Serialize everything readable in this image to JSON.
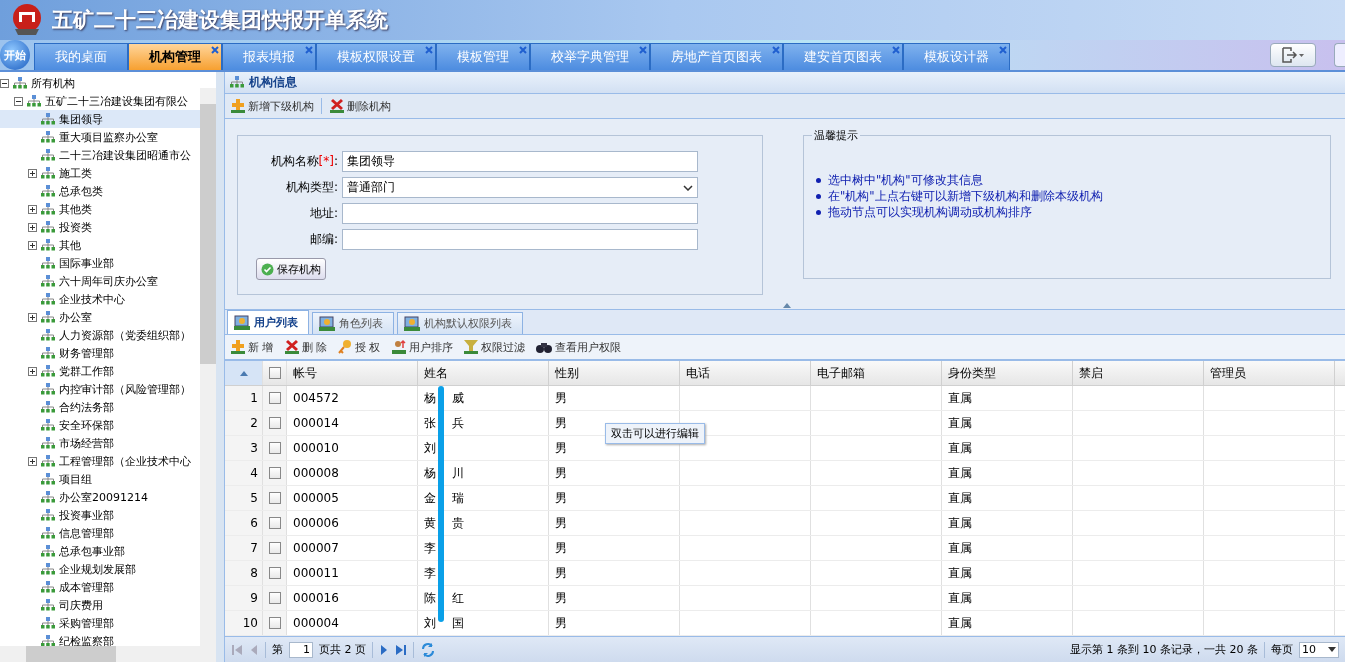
{
  "header": {
    "title": "五矿二十三冶建设集团快报开单系统"
  },
  "start_button": "开始",
  "tabs": [
    {
      "label": "我的桌面",
      "selected": false,
      "closable": false
    },
    {
      "label": "机构管理",
      "selected": true,
      "closable": true
    },
    {
      "label": "报表填报",
      "selected": false,
      "closable": true
    },
    {
      "label": "模板权限设置",
      "selected": false,
      "closable": true
    },
    {
      "label": "模板管理",
      "selected": false,
      "closable": true
    },
    {
      "label": "校举字典管理",
      "selected": false,
      "closable": true
    },
    {
      "label": "房地产首页图表",
      "selected": false,
      "closable": true
    },
    {
      "label": "建安首页图表",
      "selected": false,
      "closable": true
    },
    {
      "label": "模板设计器",
      "selected": false,
      "closable": true
    }
  ],
  "tree": [
    {
      "label": "所有机构",
      "expanded": true,
      "selected": false,
      "children": [
        {
          "label": "五矿二十三冶建设集团有限公",
          "expanded": true,
          "selected": false,
          "children": [
            {
              "label": "集团领导",
              "selected": true
            },
            {
              "label": "重大项目监察办公室",
              "selected": false
            },
            {
              "label": "二十三冶建设集团昭通市公",
              "selected": false
            },
            {
              "label": "施工类",
              "expanded": false,
              "selected": false
            },
            {
              "label": "总承包类",
              "selected": false
            },
            {
              "label": "其他类",
              "expanded": false,
              "selected": false
            },
            {
              "label": "投资类",
              "expanded": false,
              "selected": false
            },
            {
              "label": "其他",
              "expanded": false,
              "selected": false
            },
            {
              "label": "国际事业部",
              "selected": false
            },
            {
              "label": "六十周年司庆办公室",
              "selected": false
            },
            {
              "label": "企业技术中心",
              "selected": false
            },
            {
              "label": "办公室",
              "expanded": false,
              "selected": false
            },
            {
              "label": "人力资源部（党委组织部）",
              "selected": false
            },
            {
              "label": "财务管理部",
              "selected": false
            },
            {
              "label": "党群工作部",
              "expanded": false,
              "selected": false
            },
            {
              "label": "内控审计部（风险管理部）",
              "selected": false
            },
            {
              "label": "合约法务部",
              "selected": false
            },
            {
              "label": "安全环保部",
              "selected": false
            },
            {
              "label": "市场经营部",
              "selected": false
            },
            {
              "label": "工程管理部（企业技术中心",
              "expanded": false,
              "selected": false
            },
            {
              "label": "项目组",
              "selected": false
            },
            {
              "label": "办公室20091214",
              "selected": false
            },
            {
              "label": "投资事业部",
              "selected": false
            },
            {
              "label": "信息管理部",
              "selected": false
            },
            {
              "label": "总承包事业部",
              "selected": false
            },
            {
              "label": "企业规划发展部",
              "selected": false
            },
            {
              "label": "成本管理部",
              "selected": false
            },
            {
              "label": "司庆费用",
              "selected": false
            },
            {
              "label": "采购管理部",
              "selected": false
            },
            {
              "label": "纪检监察部",
              "selected": false
            }
          ]
        }
      ]
    }
  ],
  "panel": {
    "title": "机构信息",
    "toolbar": [
      {
        "label": "新增下级机构",
        "kind": "add"
      },
      {
        "label": "删除机构",
        "kind": "delete"
      }
    ]
  },
  "form": {
    "fields": [
      {
        "label": "机构名称",
        "required": "[*]",
        "label_end": ":",
        "kind": "text",
        "value": "集团领导"
      },
      {
        "label": "机构类型:",
        "kind": "select",
        "value": "普通部门"
      },
      {
        "label": "地址:",
        "kind": "text"
      },
      {
        "label": "邮编:",
        "kind": "text"
      }
    ],
    "save_button": "保存机构"
  },
  "tips": {
    "title": "温馨提示",
    "items": [
      "选中树中\"机构\"可修改其信息",
      "在\"机构\"上点右键可以新增下级机构和删除本级机构",
      "拖动节点可以实现机构调动或机构排序"
    ]
  },
  "subtabs": [
    {
      "label": "用户列表",
      "selected": true
    },
    {
      "label": "角色列表",
      "selected": false
    },
    {
      "label": "机构默认权限列表",
      "selected": false
    }
  ],
  "grid_toolbar": [
    {
      "label": "新 增",
      "kind": "add"
    },
    {
      "label": "删 除",
      "kind": "delete"
    },
    {
      "label": "授 权",
      "kind": "key"
    },
    {
      "label": "用户排序",
      "kind": "sort"
    },
    {
      "label": "权限过滤",
      "kind": "filter"
    },
    {
      "label": "查看用户权限",
      "kind": "binoculars"
    }
  ],
  "grid": {
    "select_all_checked": false,
    "columns": [
      "帐号",
      "姓名",
      "性别",
      "电话",
      "电子邮箱",
      "身份类型",
      "禁启",
      "管理员"
    ],
    "rows": [
      {
        "num": "1",
        "checked": false,
        "account": "004572",
        "name": "杨 威",
        "gender": "男",
        "identity": "直属"
      },
      {
        "num": "2",
        "checked": false,
        "account": "000014",
        "name": "张 兵",
        "gender": "男",
        "identity": "直属"
      },
      {
        "num": "3",
        "checked": false,
        "account": "000010",
        "name": "刘",
        "gender": "男",
        "identity": "直属"
      },
      {
        "num": "4",
        "checked": false,
        "account": "000008",
        "name": "杨 川",
        "gender": "男",
        "identity": "直属"
      },
      {
        "num": "5",
        "checked": false,
        "account": "000005",
        "name": "金 瑞",
        "gender": "男",
        "identity": "直属"
      },
      {
        "num": "6",
        "checked": false,
        "account": "000006",
        "name": "黄 贵",
        "gender": "男",
        "identity": "直属"
      },
      {
        "num": "7",
        "checked": false,
        "account": "000007",
        "name": "李",
        "gender": "男",
        "identity": "直属"
      },
      {
        "num": "8",
        "checked": false,
        "account": "000011",
        "name": "李",
        "gender": "男",
        "identity": "直属"
      },
      {
        "num": "9",
        "checked": false,
        "account": "000016",
        "name": "陈 红",
        "gender": "男",
        "identity": "直属"
      },
      {
        "num": "10",
        "checked": false,
        "account": "000004",
        "name": "刘 国",
        "gender": "男",
        "identity": "直属"
      }
    ]
  },
  "tooltip": "双击可以进行编辑",
  "pager": {
    "page_prefix": "第",
    "page": "1",
    "page_suffix": "页共 2 页",
    "summary": "显示第 1 条到 10 条记录，一共 20 条",
    "per_page_label": "每页",
    "per_page": "10"
  }
}
